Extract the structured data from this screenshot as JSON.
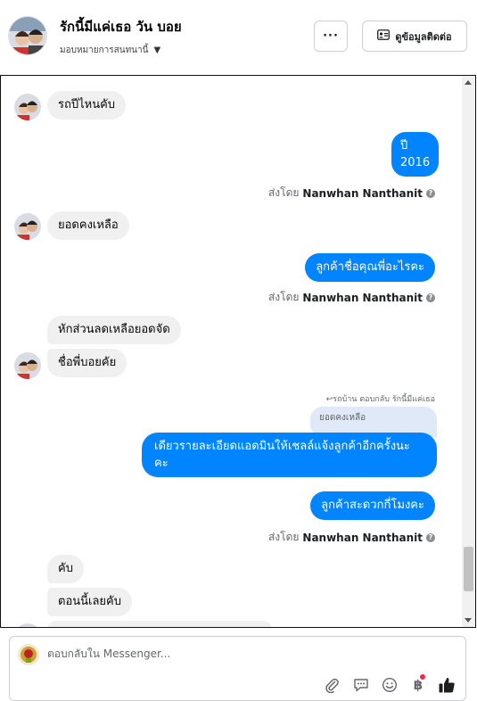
{
  "header": {
    "contact_name": "รักนี้มีแค่เธอ วัน บอย",
    "assign_label": "มอบหมายการสนทนานี้",
    "more_label": "···",
    "info_button_label": "ดูข้อมูลติดต่อ"
  },
  "messages": {
    "m1": "รถปีไหนคับ",
    "m2_line1": "ปี",
    "m2_line2": "2016",
    "m3": "ยอดคงเหลือ",
    "m4": "ลูกค้าชื่อคุณพี่อะไรคะ",
    "m5": "หักส่วนลดเหลือยอดจัด",
    "m6": "ชื่อพี่บอยคัย",
    "reply_meta": "↩รถบ้าน ตอบกลับ รักนี้มีแค่เธอ",
    "quoted": "ยอดคงเหลือ",
    "m7_line1": "เดียวรายละเอียดแอดมินให้เชลล์แจ้งลูกค้าอีกครั้งนะ",
    "m7_line2": "คะ",
    "m8": "ลูกค้าสะดวกกี่โมงคะ",
    "m9": "คับ",
    "m10": "ตอนนี้เลยคับ"
  },
  "sent_by": {
    "prefix": "ส่งโดย",
    "name": "Nanwhan Nanthanit",
    "info": "?"
  },
  "composer": {
    "placeholder": "ตอบกลับใน Messenger..."
  },
  "icons": {
    "attach": "paperclip-icon",
    "saved_reply": "chat-bubble-icon",
    "emoji": "smiley-icon",
    "payment": "baht-icon",
    "like": "thumbs-up-icon"
  },
  "colors": {
    "outgoing_bubble": "#0084ff",
    "incoming_bubble": "#f0f0f0",
    "like_icon": "#1c1e21",
    "notification_dot": "#f02849"
  }
}
